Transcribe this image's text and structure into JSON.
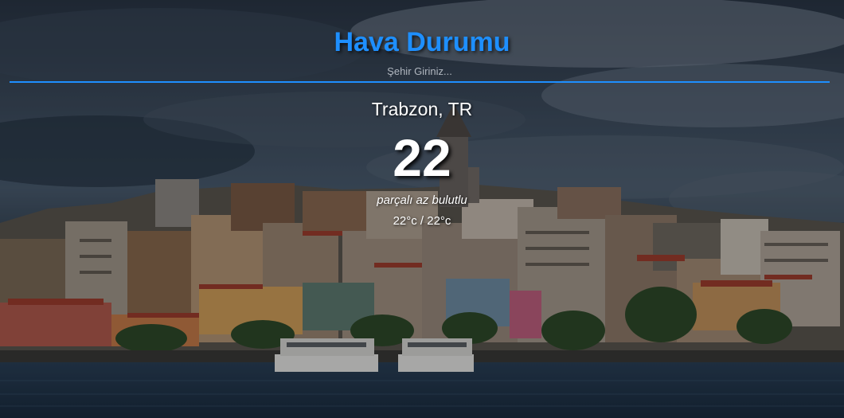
{
  "app": {
    "title": "Hava Durumu"
  },
  "search": {
    "placeholder": "Şehir Giriniz...",
    "value": ""
  },
  "weather": {
    "city": "Trabzon, TR",
    "temperature": "22",
    "description": "parçalı az bulutlu",
    "min_max": "22°c / 22°c"
  },
  "theme": {
    "accent": "#1e8fff",
    "text": "#ffffff"
  },
  "background": {
    "icon": "city-skyline-photo"
  }
}
